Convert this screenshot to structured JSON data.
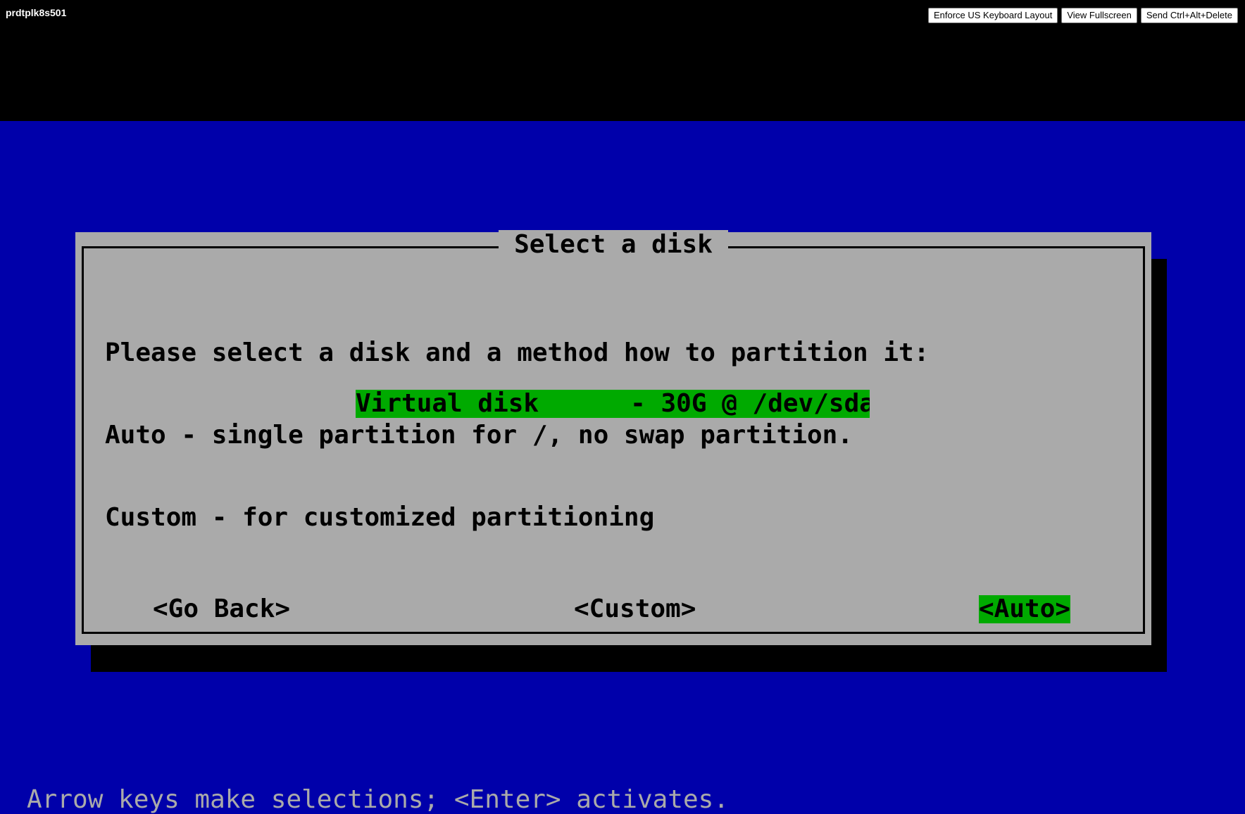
{
  "console": {
    "host": "prdtplk8s501",
    "buttons": {
      "keyboard": "Enforce US Keyboard Layout",
      "fullscreen": "View Fullscreen",
      "cad": "Send Ctrl+Alt+Delete"
    }
  },
  "dialog": {
    "title": "Select a disk",
    "lines": [
      "Please select a disk and a method how to partition it:",
      "Auto - single partition for /, no swap partition.",
      "Custom - for customized partitioning"
    ],
    "disk_item": "Virtual disk      - 30G @ /dev/sda",
    "buttons": {
      "back": "<Go Back>",
      "custom": "<Custom>",
      "auto": "<Auto>"
    }
  },
  "hint": "Arrow keys make selections; <Enter> activates.",
  "colors": {
    "screen_bg": "#0000aa",
    "dialog_bg": "#aaaaaa",
    "highlight": "#00aa00"
  }
}
